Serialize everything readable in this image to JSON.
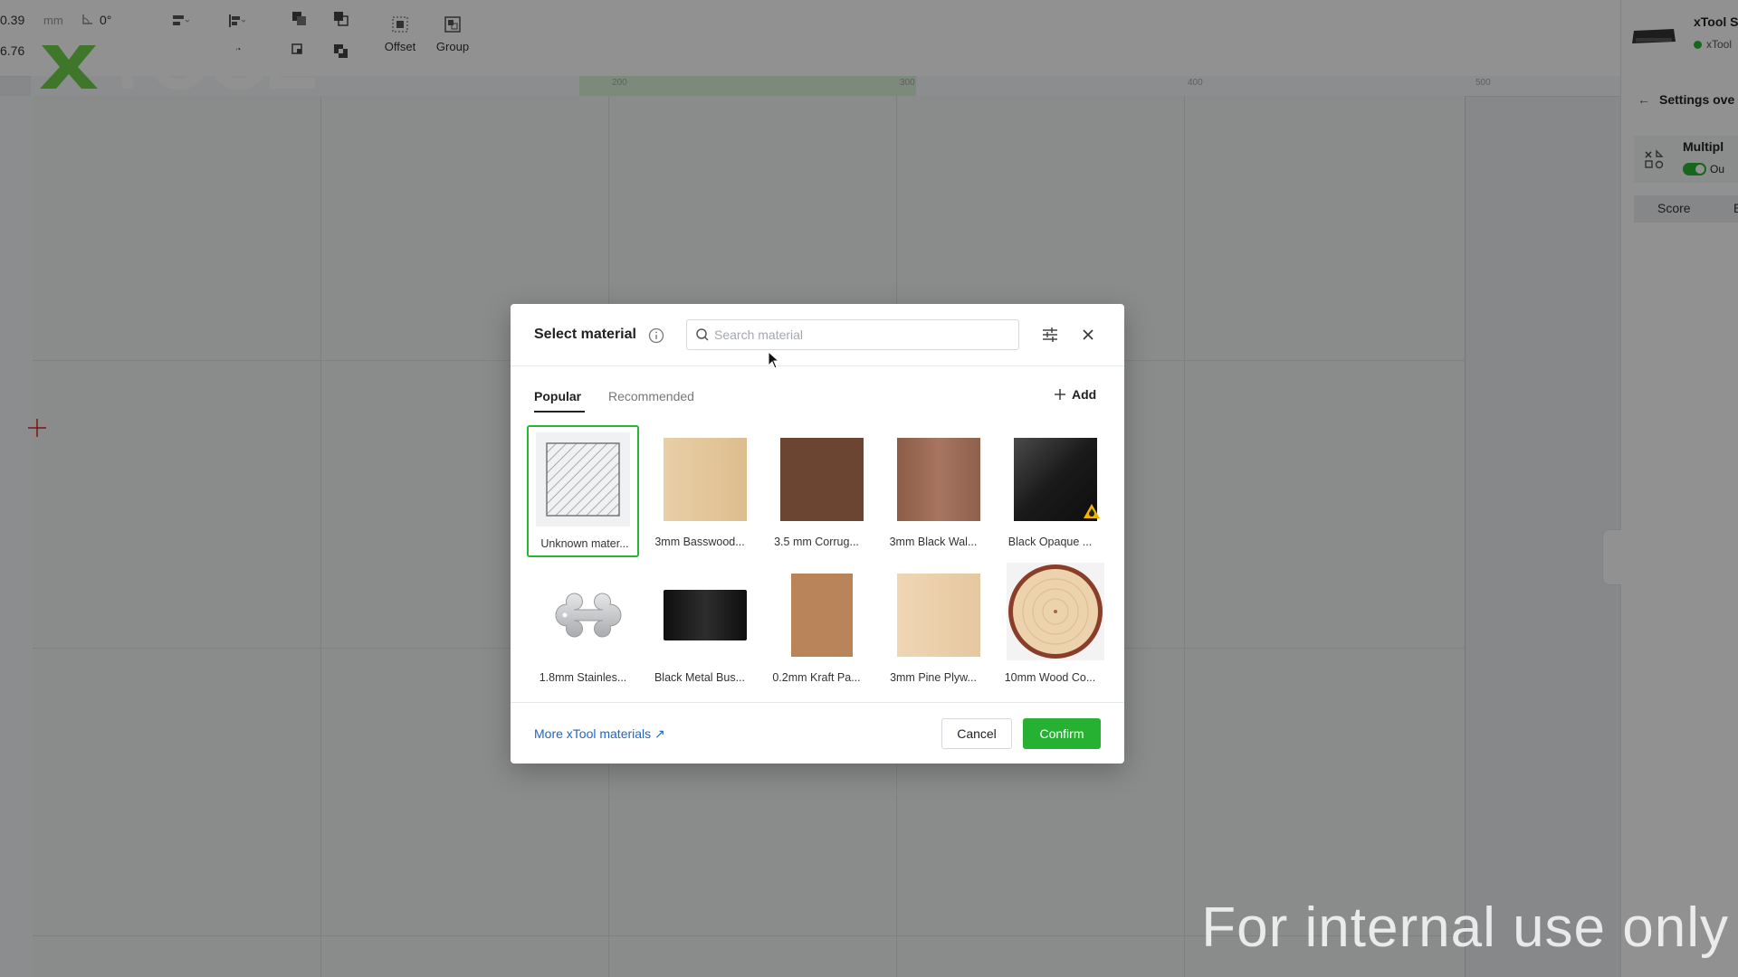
{
  "toolbar": {
    "x_value": "0.39",
    "x_unit": "mm",
    "rotation_value": "0°",
    "y_value": "6.76",
    "offset_label": "Offset",
    "group_label": "Group"
  },
  "brand": {
    "logo_text": "XTOOL",
    "accent_color": "#27b533"
  },
  "ruler": {
    "top_ticks": [
      "200",
      "300",
      "400",
      "500"
    ]
  },
  "right_panel": {
    "device_name": "xTool S",
    "device_status": "xTool",
    "settings_title": "Settings ove",
    "mode_label": "Multipl",
    "toggle_label": "Ou",
    "tab_score": "Score",
    "tab_e": "E"
  },
  "dialog": {
    "title": "Select material",
    "search_placeholder": "Search material",
    "tabs": [
      {
        "label": "Popular",
        "active": true
      },
      {
        "label": "Recommended",
        "active": false
      }
    ],
    "add_label": "Add",
    "materials": [
      {
        "label": "Unknown mater...",
        "selected": true,
        "thumb": "hatched"
      },
      {
        "label": "3mm Basswood...",
        "thumb": "basswood"
      },
      {
        "label": "3.5 mm Corrug...",
        "thumb": "corrugated"
      },
      {
        "label": "3mm Black Wal...",
        "thumb": "walnut"
      },
      {
        "label": "Black Opaque ...",
        "thumb": "black-acrylic",
        "warning": true
      },
      {
        "label": "1.8mm Stainles...",
        "thumb": "bone-tag"
      },
      {
        "label": "Black Metal Bus...",
        "thumb": "metal-card"
      },
      {
        "label": "0.2mm Kraft Pa...",
        "thumb": "kraft"
      },
      {
        "label": "3mm Pine Plyw...",
        "thumb": "pine"
      },
      {
        "label": "10mm Wood Co...",
        "thumb": "wood-slice"
      }
    ],
    "more_link": "More xTool materials ↗",
    "cancel_label": "Cancel",
    "confirm_label": "Confirm"
  },
  "watermark": "For internal use only"
}
